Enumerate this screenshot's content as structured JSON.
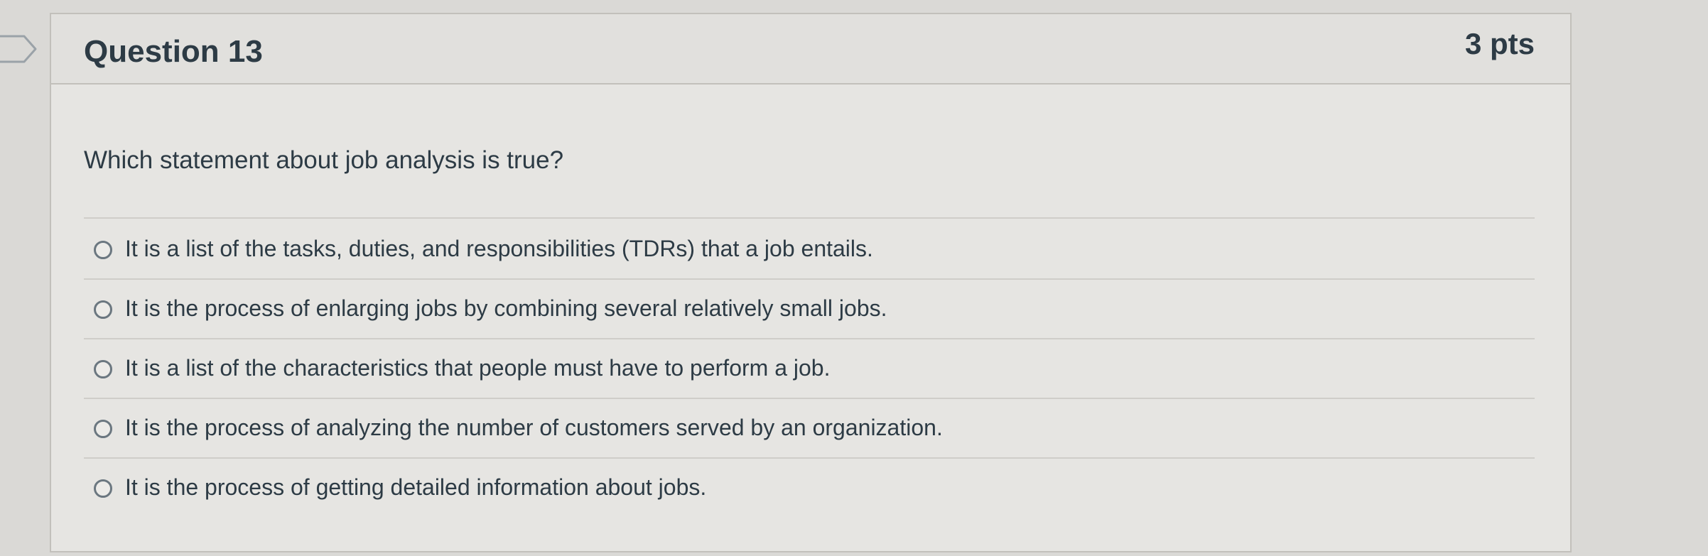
{
  "question": {
    "title": "Question 13",
    "points": "3 pts",
    "text": "Which statement about job analysis is true?",
    "answers": [
      {
        "label": "It is a list of the tasks, duties, and responsibilities (TDRs) that a job entails.",
        "selected": false
      },
      {
        "label": "It is the process of enlarging jobs by combining several relatively small jobs.",
        "selected": false
      },
      {
        "label": "It is a list of the characteristics that people must have to perform a job.",
        "selected": false
      },
      {
        "label": "It is the process of analyzing the number of customers served by an organization.",
        "selected": false
      },
      {
        "label": "It is the process of getting detailed information about jobs.",
        "selected": false
      }
    ]
  },
  "icons": {
    "flag": "bookmark-flag-icon",
    "radio": "radio-unselected"
  },
  "colors": {
    "text": "#2d3b45",
    "border": "#c2c0bb",
    "background": "#e6e5e2"
  }
}
